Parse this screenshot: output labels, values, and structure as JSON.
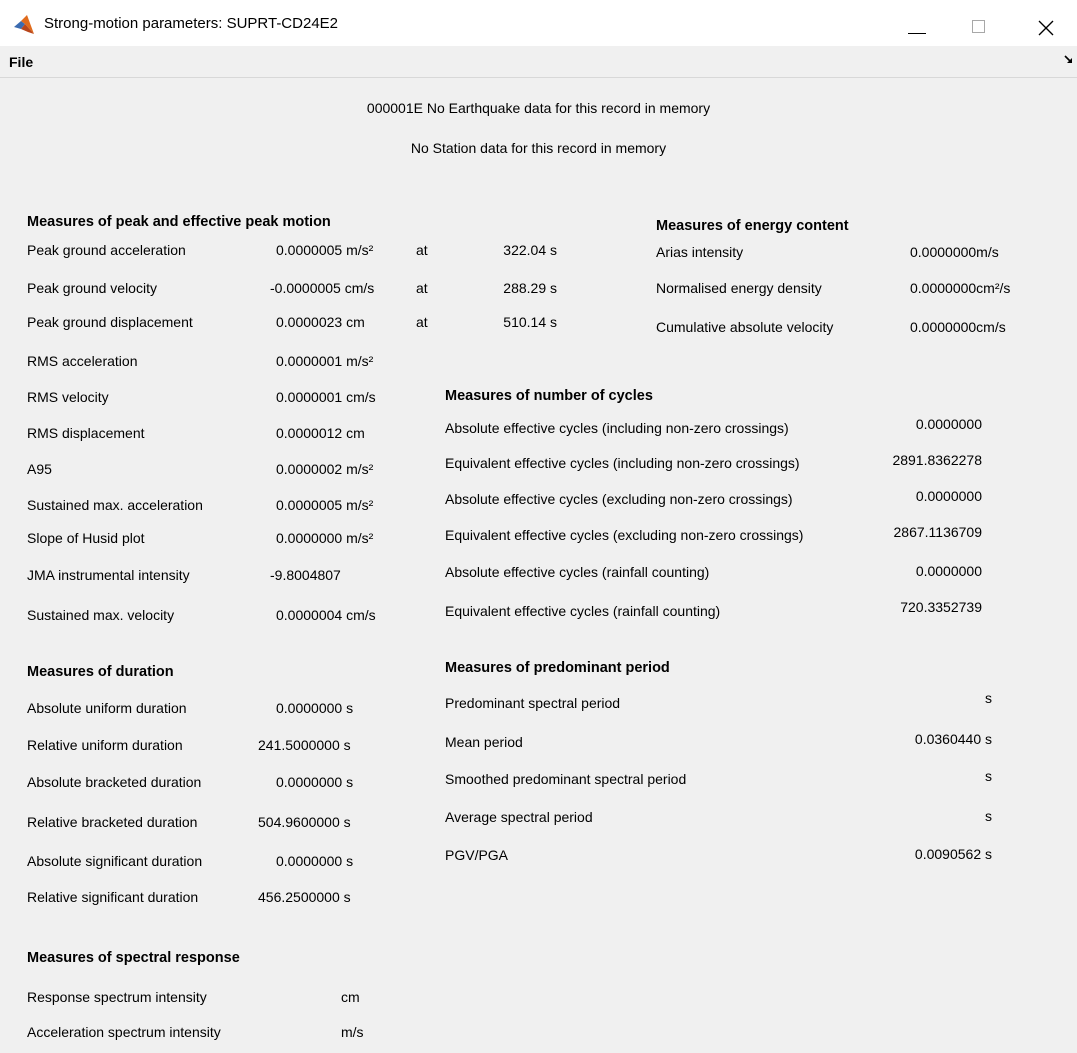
{
  "window": {
    "title": "Strong-motion parameters: SUPRT-CD24E2",
    "minimize_glyph": "—",
    "maximize_glyph": "☐",
    "close_glyph": "✕"
  },
  "menu": {
    "file": "File"
  },
  "info": {
    "earthquake": "000001E No Earthquake data for this record in memory",
    "station": "No Station data for this record in memory"
  },
  "peak": {
    "heading": "Measures of peak and effective peak motion",
    "rows": [
      {
        "label": "Peak ground acceleration",
        "value": "0.0000005 m/s²",
        "at": "at",
        "time": "322.04 s"
      },
      {
        "label": "Peak ground velocity",
        "value": "-0.0000005 cm/s",
        "at": "at",
        "time": "288.29 s"
      },
      {
        "label": "Peak ground displacement",
        "value": "0.0000023 cm",
        "at": "at",
        "time": "510.14 s"
      },
      {
        "label": "RMS acceleration",
        "value": "0.0000001 m/s²"
      },
      {
        "label": "RMS velocity",
        "value": "0.0000001 cm/s"
      },
      {
        "label": "RMS displacement",
        "value": "0.0000012 cm"
      },
      {
        "label": "A95",
        "value": "0.0000002 m/s²"
      },
      {
        "label": "Sustained max. acceleration",
        "value": "0.0000005 m/s²"
      },
      {
        "label": "Slope of Husid plot",
        "value": "0.0000000 m/s²"
      },
      {
        "label": "JMA instrumental intensity",
        "value": "-9.8004807"
      },
      {
        "label": "Sustained max. velocity",
        "value": "0.0000004 cm/s"
      }
    ]
  },
  "duration": {
    "heading": "Measures of duration",
    "rows": [
      {
        "label": "Absolute uniform duration",
        "value": "0.0000000 s"
      },
      {
        "label": "Relative uniform duration",
        "value": "241.5000000 s"
      },
      {
        "label": "Absolute bracketed duration",
        "value": "0.0000000 s"
      },
      {
        "label": "Relative bracketed duration",
        "value": "504.9600000 s"
      },
      {
        "label": "Absolute significant duration",
        "value": "0.0000000 s"
      },
      {
        "label": "Relative significant duration",
        "value": "456.2500000 s"
      }
    ]
  },
  "spectral": {
    "heading": "Measures of spectral response",
    "rows": [
      {
        "label": "Response spectrum intensity",
        "value": "cm"
      },
      {
        "label": "Acceleration spectrum intensity",
        "value": "m/s"
      }
    ]
  },
  "energy": {
    "heading": "Measures of energy content",
    "rows": [
      {
        "label": "Arias intensity",
        "value": "0.0000000m/s"
      },
      {
        "label": "Normalised energy density",
        "value": "0.0000000cm²/s"
      },
      {
        "label": "Cumulative absolute velocity",
        "value": "0.0000000cm/s"
      }
    ]
  },
  "cycles": {
    "heading": "Measures of number of cycles",
    "rows": [
      {
        "label": "Absolute effective cycles (including non-zero crossings)",
        "value": "0.0000000"
      },
      {
        "label": "Equivalent effective cycles (including non-zero crossings)",
        "value": "2891.8362278"
      },
      {
        "label": "Absolute effective cycles (excluding non-zero crossings)",
        "value": "0.0000000"
      },
      {
        "label": "Equivalent effective cycles (excluding non-zero crossings)",
        "value": "2867.1136709"
      },
      {
        "label": "Absolute effective cycles (rainfall counting)",
        "value": "0.0000000"
      },
      {
        "label": "Equivalent effective cycles (rainfall counting)",
        "value": "720.3352739"
      }
    ]
  },
  "period": {
    "heading": "Measures of predominant period",
    "rows": [
      {
        "label": "Predominant spectral period",
        "value": "s"
      },
      {
        "label": "Mean period",
        "value": "0.0360440 s"
      },
      {
        "label": "Smoothed predominant spectral period",
        "value": "s"
      },
      {
        "label": "Average spectral period",
        "value": "s"
      },
      {
        "label": "PGV/PGA",
        "value": "0.0090562 s"
      }
    ]
  }
}
